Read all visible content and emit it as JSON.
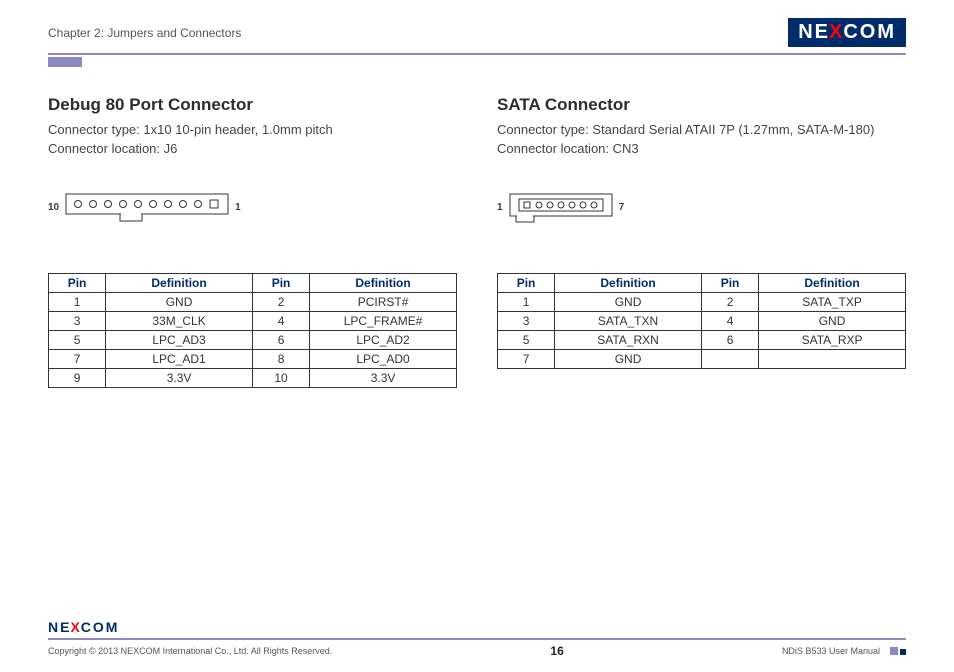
{
  "header": {
    "chapter": "Chapter 2: Jumpers and Connectors",
    "brand_left": "NE",
    "brand_x": "X",
    "brand_right": "COM"
  },
  "left": {
    "title": "Debug 80 Port Connector",
    "conn_type": "Connector type: 1x10 10-pin header, 1.0mm pitch",
    "conn_loc": "Connector location: J6",
    "pin_left_label": "10",
    "pin_right_label": "1",
    "table_head": {
      "pin": "Pin",
      "def": "Definition"
    },
    "rows": [
      {
        "p1": "1",
        "d1": "GND",
        "p2": "2",
        "d2": "PCIRST#"
      },
      {
        "p1": "3",
        "d1": "33M_CLK",
        "p2": "4",
        "d2": "LPC_FRAME#"
      },
      {
        "p1": "5",
        "d1": "LPC_AD3",
        "p2": "6",
        "d2": "LPC_AD2"
      },
      {
        "p1": "7",
        "d1": "LPC_AD1",
        "p2": "8",
        "d2": "LPC_AD0"
      },
      {
        "p1": "9",
        "d1": "3.3V",
        "p2": "10",
        "d2": "3.3V"
      }
    ]
  },
  "right": {
    "title": "SATA Connector",
    "conn_type": "Connector type: Standard Serial ATAII 7P (1.27mm, SATA-M-180)",
    "conn_loc": "Connector location: CN3",
    "pin_left_label": "1",
    "pin_right_label": "7",
    "table_head": {
      "pin": "Pin",
      "def": "Definition"
    },
    "rows": [
      {
        "p1": "1",
        "d1": "GND",
        "p2": "2",
        "d2": "SATA_TXP"
      },
      {
        "p1": "3",
        "d1": "SATA_TXN",
        "p2": "4",
        "d2": "GND"
      },
      {
        "p1": "5",
        "d1": "SATA_RXN",
        "p2": "6",
        "d2": "SATA_RXP"
      },
      {
        "p1": "7",
        "d1": "GND",
        "p2": "",
        "d2": ""
      }
    ]
  },
  "footer": {
    "copyright": "Copyright © 2013 NEXCOM International Co., Ltd. All Rights Reserved.",
    "page": "16",
    "manual": "NDiS B533 User Manual"
  }
}
